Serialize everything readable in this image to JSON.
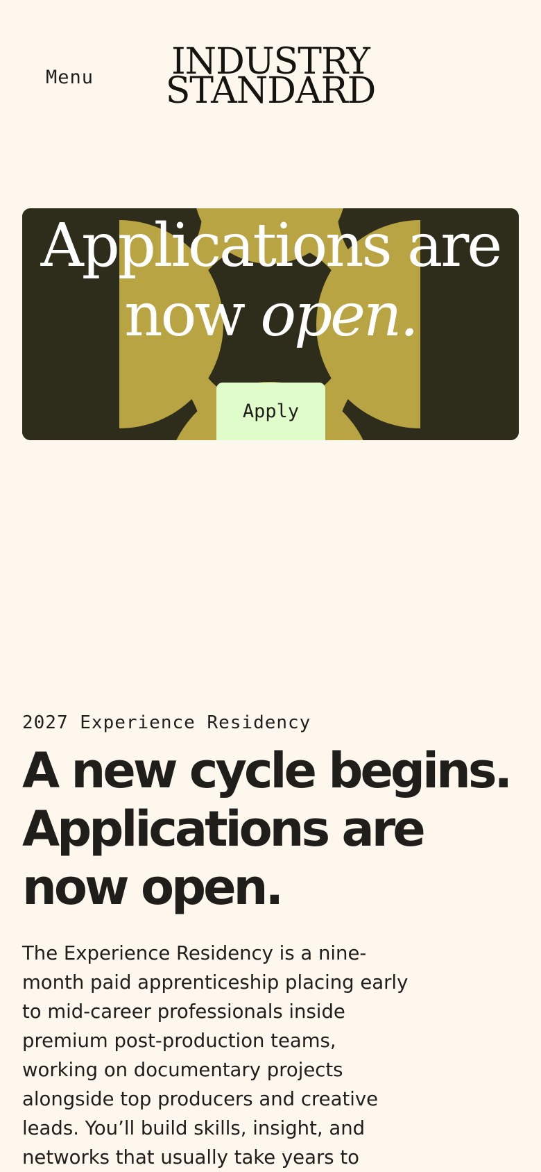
{
  "header": {
    "menu_label": "Menu",
    "logo_line1": "INDUSTRY",
    "logo_line2": "STANDARD"
  },
  "hero": {
    "title_part1": "Applications are",
    "title_part2": "now ",
    "title_emphasis": "open.",
    "apply_label": "Apply",
    "colors": {
      "background": "#2e2c1a",
      "pattern": "#b8a443",
      "button": "#e1fccb"
    }
  },
  "content": {
    "eyebrow": "2027 Experience Residency",
    "headline": "A new cycle begins. Applications are now open.",
    "body": "The Experience Residency is a nine-month paid apprenticeship placing early to mid-career professionals inside premium post-production teams, working on documentary projects alongside top producers and creative leads. You’ll build skills, insight, and networks that usually take years to"
  }
}
